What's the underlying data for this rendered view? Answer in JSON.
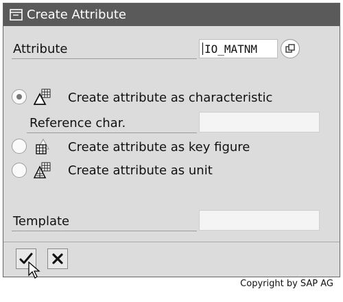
{
  "dialog": {
    "title": "Create Attribute",
    "attribute_label": "Attribute",
    "attribute_value": "IO_MATNM",
    "options": [
      {
        "label": "Create attribute as characteristic",
        "selected": true,
        "icon": "characteristic-icon"
      },
      {
        "label": "Create attribute as key figure",
        "selected": false,
        "icon": "key-figure-icon"
      },
      {
        "label": "Create attribute as unit",
        "selected": false,
        "icon": "unit-icon"
      }
    ],
    "reference_label": "Reference char.",
    "reference_value": "",
    "template_label": "Template",
    "template_value": ""
  },
  "buttons": {
    "continue_icon": "checkmark-icon",
    "cancel_icon": "cancel-x-icon"
  },
  "copyright": "Copyright by SAP AG"
}
